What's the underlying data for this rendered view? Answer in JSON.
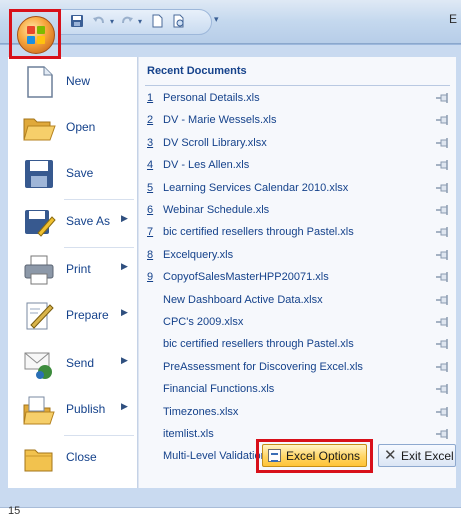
{
  "titlebar": {
    "trailing_char": "E"
  },
  "qat": {
    "icons": [
      "save-icon",
      "undo-icon",
      "redo-icon",
      "new-document-icon",
      "print-preview-icon",
      "customize-dropdown-icon"
    ]
  },
  "menu": {
    "commands": [
      {
        "label": "New",
        "icon": "new-document-icon",
        "submenu": false
      },
      {
        "label": "Open",
        "icon": "open-folder-icon",
        "submenu": false
      },
      {
        "label": "Save",
        "icon": "save-icon",
        "submenu": false
      },
      {
        "label": "Save As",
        "icon": "save-as-icon",
        "submenu": true
      },
      {
        "label": "Print",
        "icon": "printer-icon",
        "submenu": true
      },
      {
        "label": "Prepare",
        "icon": "prepare-icon",
        "submenu": true
      },
      {
        "label": "Send",
        "icon": "send-icon",
        "submenu": true
      },
      {
        "label": "Publish",
        "icon": "publish-icon",
        "submenu": true
      },
      {
        "label": "Close",
        "icon": "close-folder-icon",
        "submenu": false
      }
    ],
    "recent": {
      "title": "Recent Documents",
      "items": [
        {
          "num": "1",
          "name": "Personal Details.xls"
        },
        {
          "num": "2",
          "name": "DV - Marie Wessels.xls"
        },
        {
          "num": "3",
          "name": "DV Scroll Library.xlsx"
        },
        {
          "num": "4",
          "name": "DV - Les Allen.xls"
        },
        {
          "num": "5",
          "name": "Learning Services Calendar 2010.xlsx"
        },
        {
          "num": "6",
          "name": "Webinar Schedule.xls"
        },
        {
          "num": "7",
          "name": "bic certified resellers through Pastel.xls"
        },
        {
          "num": "8",
          "name": "Excelquery.xls"
        },
        {
          "num": "9",
          "name": "CopyofSalesMasterHPP20071.xls"
        },
        {
          "num": "",
          "name": "New  Dashboard Active Data.xlsx"
        },
        {
          "num": "",
          "name": "CPC's 2009.xlsx"
        },
        {
          "num": "",
          "name": "bic certified resellers through Pastel.xls"
        },
        {
          "num": "",
          "name": "PreAssessment for Discovering Excel.xls"
        },
        {
          "num": "",
          "name": "Financial Functions.xls"
        },
        {
          "num": "",
          "name": "Timezones.xlsx"
        },
        {
          "num": "",
          "name": "itemlist.xls"
        },
        {
          "num": "",
          "name": "Multi-Level Validation Lists.xlsx"
        }
      ]
    }
  },
  "footer": {
    "options_label": "Excel Options",
    "exit_label": "Exit Excel"
  },
  "status": {
    "cell_ref": "15"
  },
  "colors": {
    "highlight_box": "#d8101a",
    "menu_text": "#15428b",
    "menu_frame": "#c9daf0"
  }
}
